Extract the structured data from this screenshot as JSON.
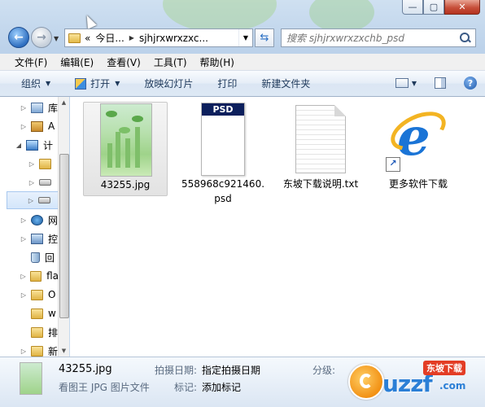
{
  "window": {
    "title_buttons": {
      "minimize": "—",
      "maximize": "▢",
      "close": "✕"
    }
  },
  "address": {
    "segments": [
      "«",
      "今日...",
      "sjhjrxwrxzxc..."
    ]
  },
  "search": {
    "placeholder": "搜索 sjhjrxwrxzxchb_psd"
  },
  "menu": [
    "文件(F)",
    "编辑(E)",
    "查看(V)",
    "工具(T)",
    "帮助(H)"
  ],
  "toolbar": {
    "organize": "组织",
    "open": "打开",
    "slideshow": "放映幻灯片",
    "print": "打印",
    "new_folder": "新建文件夹"
  },
  "nav": {
    "items": [
      {
        "label": "库",
        "icon": "library-icon"
      },
      {
        "label": "A",
        "icon": "user-folder-icon"
      },
      {
        "label": "计",
        "icon": "computer-icon"
      },
      {
        "label": "",
        "icon": "local-disk-icon"
      },
      {
        "label": "",
        "icon": "drive-icon"
      },
      {
        "label": "",
        "icon": "drive-icon"
      },
      {
        "label": "网",
        "icon": "network-icon"
      },
      {
        "label": "控",
        "icon": "control-panel-icon"
      },
      {
        "label": "回",
        "icon": "recycle-bin-icon"
      },
      {
        "label": "fla",
        "icon": "folder-icon"
      },
      {
        "label": "O",
        "icon": "folder-icon"
      },
      {
        "label": "w",
        "icon": "folder-icon"
      },
      {
        "label": "排",
        "icon": "folder-icon"
      },
      {
        "label": "新",
        "icon": "folder-icon"
      }
    ]
  },
  "files": [
    {
      "name": "43255.jpg",
      "icon": "image-thumbnail",
      "selected": true
    },
    {
      "name": "558968c921460.psd",
      "icon": "psd-file-icon",
      "psd_band": "PSD"
    },
    {
      "name": "东坡下载说明.txt",
      "icon": "text-file-icon"
    },
    {
      "name": "更多软件下载",
      "icon": "internet-explorer-shortcut-icon"
    }
  ],
  "details": {
    "name": "43255.jpg",
    "type": "看图王 JPG 图片文件",
    "date_taken_key": "拍摄日期:",
    "date_taken_val": "指定拍摄日期",
    "tags_key": "标记:",
    "tags_val": "添加标记",
    "rating_key": "分级:"
  },
  "watermark": {
    "brand": "uzzf",
    "suffix": ".com",
    "tag": "东坡下载"
  }
}
